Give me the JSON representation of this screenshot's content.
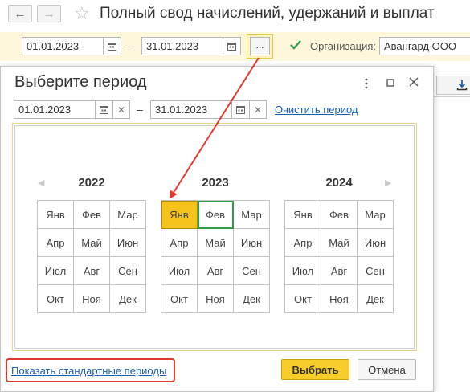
{
  "report": {
    "title": "Полный свод начислений, удержаний и выплат",
    "date_from": "01.01.2023",
    "date_to": "31.01.2023",
    "period_select_button": "...",
    "dash": "–",
    "organization_label": "Организация:",
    "organization_value": "Авангард ООО",
    "organization_checked": true
  },
  "dialog": {
    "title": "Выберите период",
    "date_from": "01.01.2023",
    "date_to": "31.01.2023",
    "dash": "–",
    "clear_period_link": "Очистить период",
    "show_standard_periods_link": "Показать стандартные периоды",
    "choose_button": "Выбрать",
    "cancel_button": "Отмена"
  },
  "calendar": {
    "years": [
      {
        "year": "2022",
        "months": [
          "Янв",
          "Фев",
          "Мар",
          "Апр",
          "Май",
          "Июн",
          "Июл",
          "Авг",
          "Сен",
          "Окт",
          "Ноя",
          "Дек"
        ]
      },
      {
        "year": "2023",
        "months": [
          "Янв",
          "Фев",
          "Мар",
          "Апр",
          "Май",
          "Июн",
          "Июл",
          "Авг",
          "Сен",
          "Окт",
          "Ноя",
          "Дек"
        ]
      },
      {
        "year": "2024",
        "months": [
          "Янв",
          "Фев",
          "Мар",
          "Апр",
          "Май",
          "Июн",
          "Июл",
          "Авг",
          "Сен",
          "Окт",
          "Ноя",
          "Дек"
        ]
      }
    ],
    "selected": {
      "year": "2023",
      "month": "Янв"
    },
    "current": {
      "year": "2023",
      "month": "Фев"
    }
  },
  "colors": {
    "accent_yellow": "#f4c21a",
    "current_green": "#2e9a4a",
    "link_blue": "#1a5fb4",
    "annotation_red": "#e03a2f",
    "param_bar_bg": "#fff7dc"
  }
}
